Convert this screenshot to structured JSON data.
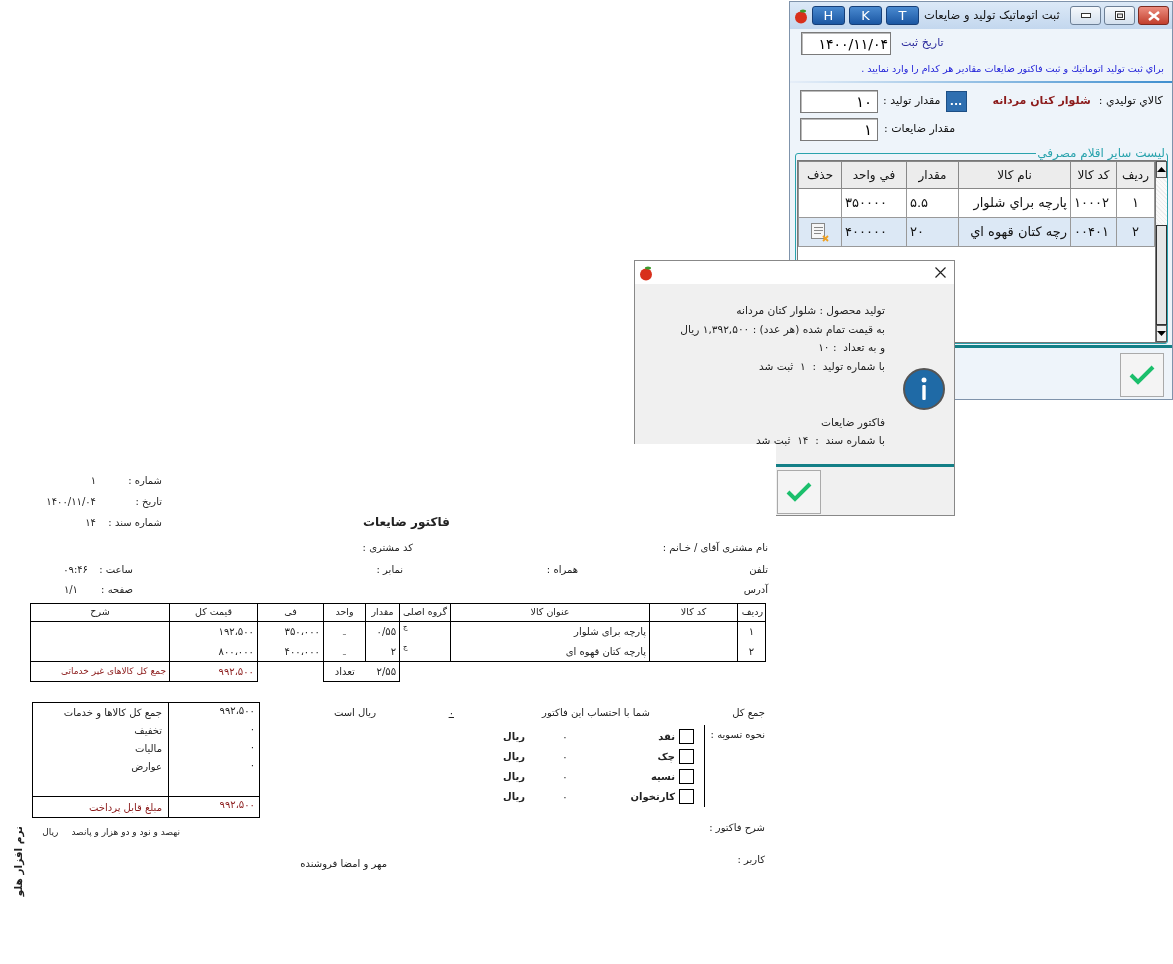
{
  "main_window": {
    "title": "ثبت اتوماتیک تولید و ضایعات",
    "title_buttons": [
      "T",
      "K",
      "H"
    ],
    "date_label": "تاریخ ثبت",
    "date_value": "۱۴۰۰/۱۱/۰۴",
    "instruction": "براي ثبت توليد اتوماتيك و ثبت فاكتور ضايعات مقادير هر كدام را وارد نماييد .",
    "product_label": "كالاي توليدي :",
    "product_name": "شلوار كتان مردانه",
    "browse_button": "...",
    "quantity_label": "مقدار توليد :",
    "quantity_value": "۱۰",
    "waste_label": "مقدار ضايعات :",
    "waste_value": "۱",
    "list_title": "ليست ساير اقلام مصرفي",
    "table": {
      "columns": [
        "رديف",
        "كد كالا",
        "نام كالا",
        "مقدار",
        "في واحد",
        "حذف"
      ],
      "rows": [
        {
          "cells": [
            "۱",
            "۱۰۰۰۲",
            "پارچه براي شلوار",
            "۵.۵",
            "۳۵۰۰۰۰"
          ],
          "selected": false
        },
        {
          "cells": [
            "۲",
            "۰۰۴۰۱",
            "رچه كتان قهوه اي",
            "۲۰",
            "۴۰۰۰۰۰"
          ],
          "selected": true
        }
      ]
    }
  },
  "dialog": {
    "message_groups": [
      [
        "توليد محصول : شلوار كتان مردانه",
        "به قيمت تمام شده (هر عدد) : ۱,۳۹۲,۵۰۰ ريال",
        "و به تعداد  : ۱۰",
        "با شماره توليد  :  ۱  ثبت شد"
      ],
      [
        "فاكتور ضايعات",
        "با شماره سند  :  ۱۴  ثبت شد"
      ]
    ]
  },
  "invoice": {
    "header_fields": [
      {
        "label": "شماره :",
        "value": "۱"
      },
      {
        "label": "تاریخ :",
        "value": "۱۴۰۰/۱۱/۰۴"
      },
      {
        "label": "شماره سند :",
        "value": "۱۴"
      }
    ],
    "title": "فاکتور ضایعات",
    "customer_label": "نام مشتری آقای / خـانم :",
    "customer_code_label": "کد مشتری :",
    "phone_label": "تلفن",
    "mobile_label": "همراه :",
    "fax_label": "نمابر :",
    "time": {
      "label": "ساعت :",
      "value": "۰۹:۴۶"
    },
    "address_label": "آدرس",
    "page": {
      "label": "صفحه :",
      "value": "۱/۱"
    },
    "table": {
      "columns": [
        "ردیف",
        "کد کالا",
        "عنوان کالا",
        "گروه اصلی",
        "مقدار",
        "واحد",
        "فی",
        "قیمت کل",
        "شرح"
      ],
      "rows": [
        [
          "۱",
          "",
          "پارچه برای شلوار",
          "ج",
          "۰/۵۵",
          "ـ",
          "۳۵۰،۰۰۰",
          "۱۹۲،۵۰۰",
          ""
        ],
        [
          "۲",
          "",
          "پارچه کتان قهوه ای",
          "ج",
          "۲",
          "ـ",
          "۴۰۰،۰۰۰",
          "۸۰۰،۰۰۰",
          ""
        ]
      ],
      "footer": {
        "count_label": "تعداد",
        "count": "۲/۵۵",
        "total": "۹۹۲،۵۰۰",
        "total_label": "جمع کل کالاهای غیر خدماتی"
      }
    },
    "grand_total_label": "جمع کل",
    "grand_total_text": "شما با احتساب این فاکتور",
    "grand_total_value": "۰",
    "grand_total_unit": "ریال است",
    "settlement_label": "نحوه تسویه :",
    "settlements": [
      {
        "label": "نقد",
        "checked": false,
        "amount": "۰",
        "unit": "ریال"
      },
      {
        "label": "چک",
        "checked": false,
        "amount": "۰",
        "unit": "ریال"
      },
      {
        "label": "نسیه",
        "checked": false,
        "amount": "۰",
        "unit": "ریال"
      },
      {
        "label": "کارتخوان",
        "checked": false,
        "amount": "۰",
        "unit": "ریال"
      }
    ],
    "description_label": "شرح فاکتور :",
    "user_label": "کاربر :",
    "signature": "مهر و امضا فروشنده",
    "summary": [
      {
        "label": "جمع کل کالاها و خدمات",
        "value": "۹۹۲،۵۰۰"
      },
      {
        "label": "تخفیف",
        "value": "۰"
      },
      {
        "label": "مالیات",
        "value": "۰"
      },
      {
        "label": "عوارض",
        "value": "۰"
      }
    ],
    "payable": {
      "label": "مبلغ قابل پرداخت",
      "value": "۹۹۲،۵۰۰"
    },
    "amount_in_words": "نهصد و نود و دو هزار و پانصد",
    "amount_unit": "ریال",
    "vendor_mark": "نرم افزار هلو"
  }
}
